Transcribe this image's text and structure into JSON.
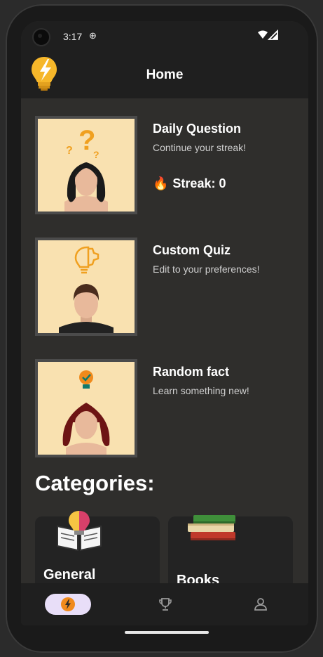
{
  "status_bar": {
    "time": "3:17"
  },
  "appbar": {
    "title": "Home"
  },
  "cards": [
    {
      "title": "Daily Question",
      "subtitle": "Continue your streak!",
      "streak": "Streak: 0"
    },
    {
      "title": "Custom Quiz",
      "subtitle": "Edit to your preferences!"
    },
    {
      "title": "Random fact",
      "subtitle": "Learn something new!"
    }
  ],
  "categories": {
    "heading": "Categories:",
    "items": [
      {
        "label": "General"
      },
      {
        "label": "Books"
      }
    ]
  },
  "bottom_nav": {
    "items": [
      {
        "icon": "bolt-icon",
        "active": true
      },
      {
        "icon": "trophy-icon",
        "active": false
      },
      {
        "icon": "person-icon",
        "active": false
      }
    ]
  },
  "colors": {
    "background": "#2f2e2c",
    "bar": "#1f1f1f",
    "card_image_bg": "#f9e1b0",
    "accent_orange": "#f08a1c",
    "nav_active_pill": "#e8def8"
  }
}
